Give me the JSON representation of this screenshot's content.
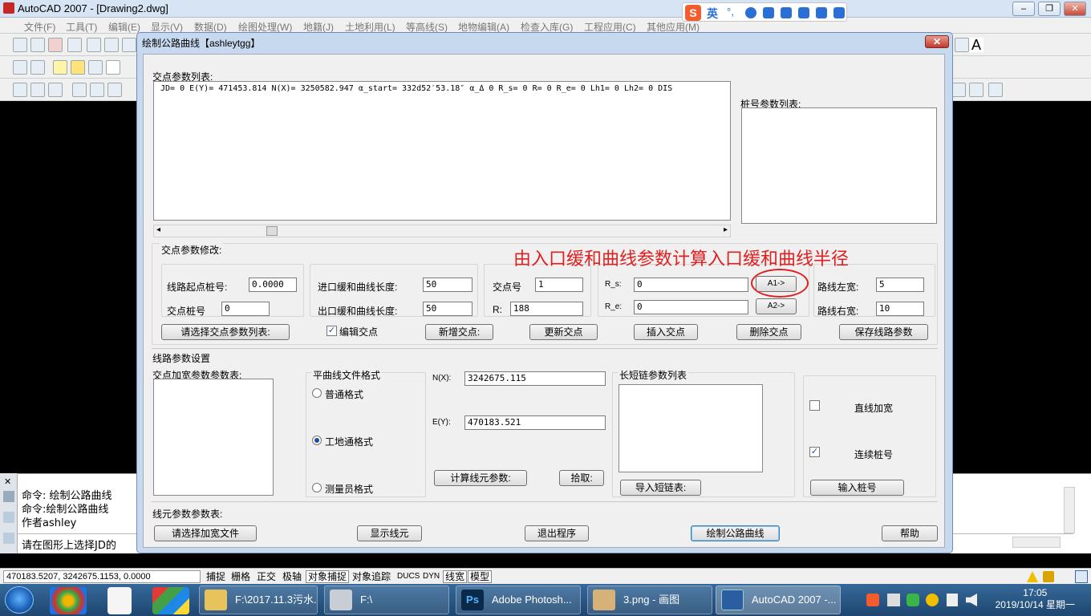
{
  "app": {
    "title": "AutoCAD 2007 - [Drawing2.dwg]",
    "menu": [
      "文件(F)",
      "工具(T)",
      "编辑(E)",
      "显示(V)",
      "数据(D)",
      "绘图处理(W)",
      "地籍(J)",
      "土地利用(L)",
      "等高线(S)",
      "地物编辑(A)",
      "检查入库(G)",
      "工程应用(C)",
      "其他应用(M)"
    ]
  },
  "ime": {
    "logo": "S",
    "lang": "英",
    "punct": "°,"
  },
  "dialog": {
    "title": "绘制公路曲线【ashleytgg】",
    "close": "✕",
    "jd_list_label": "交点参数列表:",
    "jd_list_row": "JD= 0  E(Y)= 471453.814  N(X)= 3250582.947  α_start= 332d52′53.18″  α_Δ 0  R_s= 0  R= 0  R_e= 0  Lh1= 0  Lh2= 0  DIS",
    "stake_list_label": "桩号参数列表:",
    "modify_group": "交点参数修改:",
    "start_stake_label": "线路起点桩号:",
    "start_stake_value": "0.0000",
    "jd_stake_label": "交点桩号",
    "jd_stake_value": "0",
    "in_spiral_label": "进口缓和曲线长度:",
    "in_spiral_value": "50",
    "out_spiral_label": "出口缓和曲线长度:",
    "out_spiral_value": "50",
    "jd_no_label": "交点号",
    "jd_no_value": "1",
    "r_label": "R:",
    "r_value": "188",
    "rs_label": "R_s:",
    "rs_value": "0",
    "re_label": "R_e:",
    "re_value": "0",
    "a1_btn": "A1->",
    "a2_btn": "A2->",
    "left_width_label": "路线左宽:",
    "left_width_value": "5",
    "right_width_label": "路线右宽:",
    "right_width_value": "10",
    "select_jd_list_btn": "请选择交点参数列表:",
    "edit_jd_label": "编辑交点",
    "add_jd_btn": "新增交点:",
    "update_jd_btn": "更新交点",
    "insert_jd_btn": "插入交点",
    "delete_jd_btn": "删除交点",
    "save_route_btn": "保存线路参数",
    "route_settings": "线路参数设置",
    "widen_list_label": "交点加宽参数参数表:",
    "flat_format_label": "平曲线文件格式",
    "format_options": [
      "普通格式",
      "工地通格式",
      "测量员格式"
    ],
    "format_selected": 1,
    "nx_label": "N(X):",
    "nx_value": "3242675.115",
    "ey_label": "E(Y):",
    "ey_value": "470183.521",
    "calc_btn": "计算线元参数:",
    "pick_btn": "拾取:",
    "chain_list_label": "长短链参数列表",
    "import_chain_btn": "导入短链表:",
    "straight_widen_label": "直线加宽",
    "straight_widen_checked": false,
    "continuous_stake_label": "连续桩号",
    "continuous_stake_checked": true,
    "input_stake_btn": "输入桩号",
    "element_list_label": "线元参数参数表:",
    "select_widen_file_btn": "请选择加宽文件",
    "show_element_btn": "显示线元",
    "exit_btn": "退出程序",
    "draw_curve_btn": "绘制公路曲线",
    "help_btn": "帮助"
  },
  "annotation": "由入口缓和曲线参数计算入口缓和曲线半径",
  "command": {
    "lines": [
      "命令: 绘制公路曲线",
      "命令:绘制公路曲线",
      "作者ashley"
    ],
    "prompt": "请在图形上选择JD的"
  },
  "status": {
    "coords": "470183.5207, 3242675.1153, 0.0000",
    "buttons": [
      "捕捉",
      "栅格",
      "正交",
      "极轴",
      "对象捕捉",
      "对象追踪",
      "DUCS",
      "DYN",
      "线宽",
      "模型"
    ]
  },
  "taskbar": {
    "items": [
      "F:\\2017.11.3污水...",
      "F:\\",
      "Adobe Photosh...",
      "3.png - 画图",
      "AutoCAD 2007 -..."
    ],
    "time": "17:05",
    "date": "2019/10/14 星期一"
  }
}
